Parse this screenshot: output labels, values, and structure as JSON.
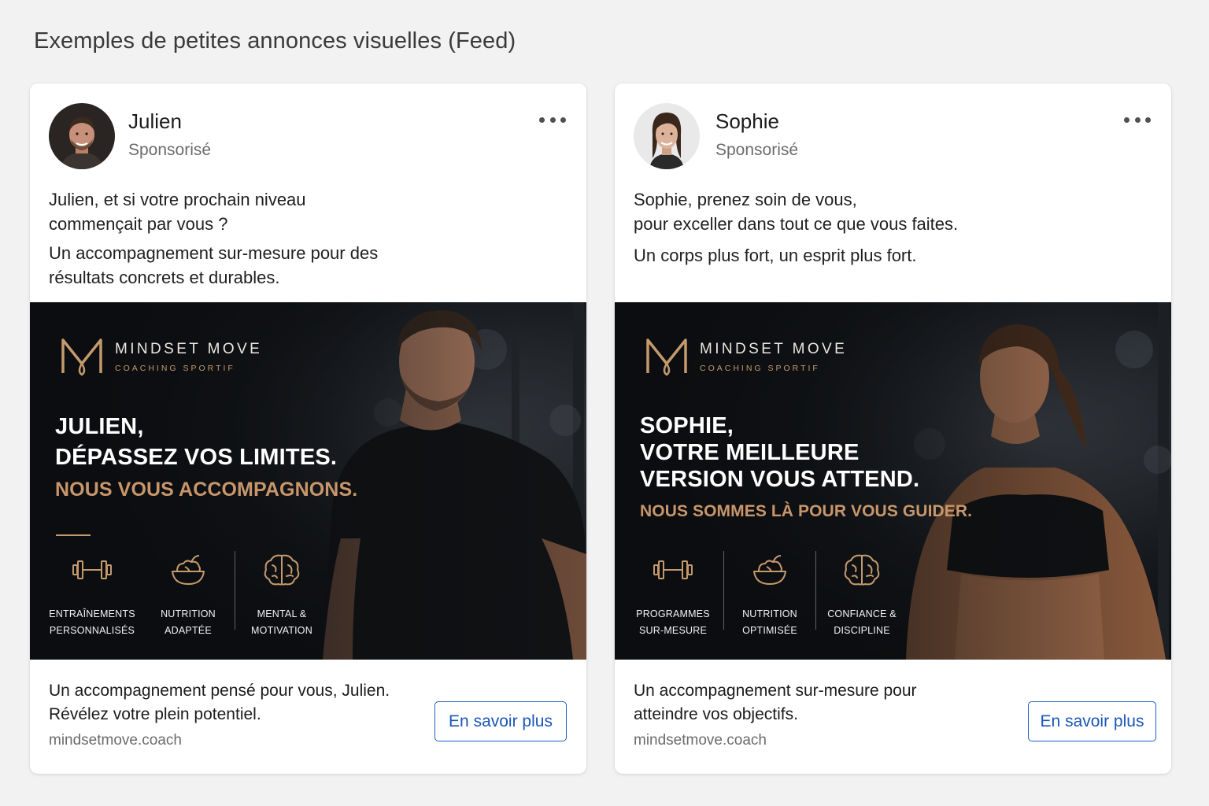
{
  "page_title": "Exemples de petites annonces visuelles (Feed)",
  "colors": {
    "accent_gold": "#c49a6c",
    "cta_blue": "#1a56b8",
    "banner_bg": "#0d0f12"
  },
  "ads": [
    {
      "author": "Julien",
      "sponsored": "Sponsorisé",
      "more_icon": "more-horizontal-icon",
      "body": [
        "Julien, et si votre prochain niveau",
        "commençait par vous ?",
        "Un accompagnement sur-mesure pour des",
        "résultats concrets et durables."
      ],
      "banner": {
        "brand": "MINDSET MOVE",
        "brand_sub": "COACHING SPORTIF",
        "headline": [
          "JULIEN,",
          "DÉPASSEZ VOS LIMITES."
        ],
        "subhead": "NOUS VOUS ACCOMPAGNONS.",
        "features": [
          {
            "icon": "dumbbell-icon",
            "line1": "ENTRAÎNEMENTS",
            "line2": "PERSONNALISÉS"
          },
          {
            "icon": "salad-bowl-icon",
            "line1": "NUTRITION",
            "line2": "ADAPTÉE"
          },
          {
            "icon": "brain-icon",
            "line1": "MENTAL &",
            "line2": "MOTIVATION"
          }
        ]
      },
      "footer": {
        "line1": "Un accompagnement pensé pour vous, Julien.",
        "line2": "Révélez votre plein potentiel.",
        "domain": "mindsetmove.coach",
        "cta": "En savoir plus"
      }
    },
    {
      "author": "Sophie",
      "sponsored": "Sponsorisé",
      "more_icon": "more-horizontal-icon",
      "body": [
        "Sophie, prenez soin de vous,",
        "pour exceller dans tout ce que vous faites.",
        "Un corps plus fort, un esprit plus fort."
      ],
      "banner": {
        "brand": "MINDSET MOVE",
        "brand_sub": "COACHING SPORTIF",
        "headline": [
          "SOPHIE,",
          "VOTRE MEILLEURE",
          "VERSION VOUS ATTEND."
        ],
        "subhead": "NOUS SOMMES LÀ POUR VOUS GUIDER.",
        "features": [
          {
            "icon": "dumbbell-icon",
            "line1": "PROGRAMMES",
            "line2": "SUR-MESURE"
          },
          {
            "icon": "salad-bowl-icon",
            "line1": "NUTRITION",
            "line2": "OPTIMISÉE"
          },
          {
            "icon": "brain-icon",
            "line1": "CONFIANCE &",
            "line2": "DISCIPLINE"
          }
        ]
      },
      "footer": {
        "line1": "Un accompagnement sur-mesure pour",
        "line2": "atteindre vos objectifs.",
        "domain": "mindsetmove.coach",
        "cta": "En savoir plus"
      }
    }
  ]
}
